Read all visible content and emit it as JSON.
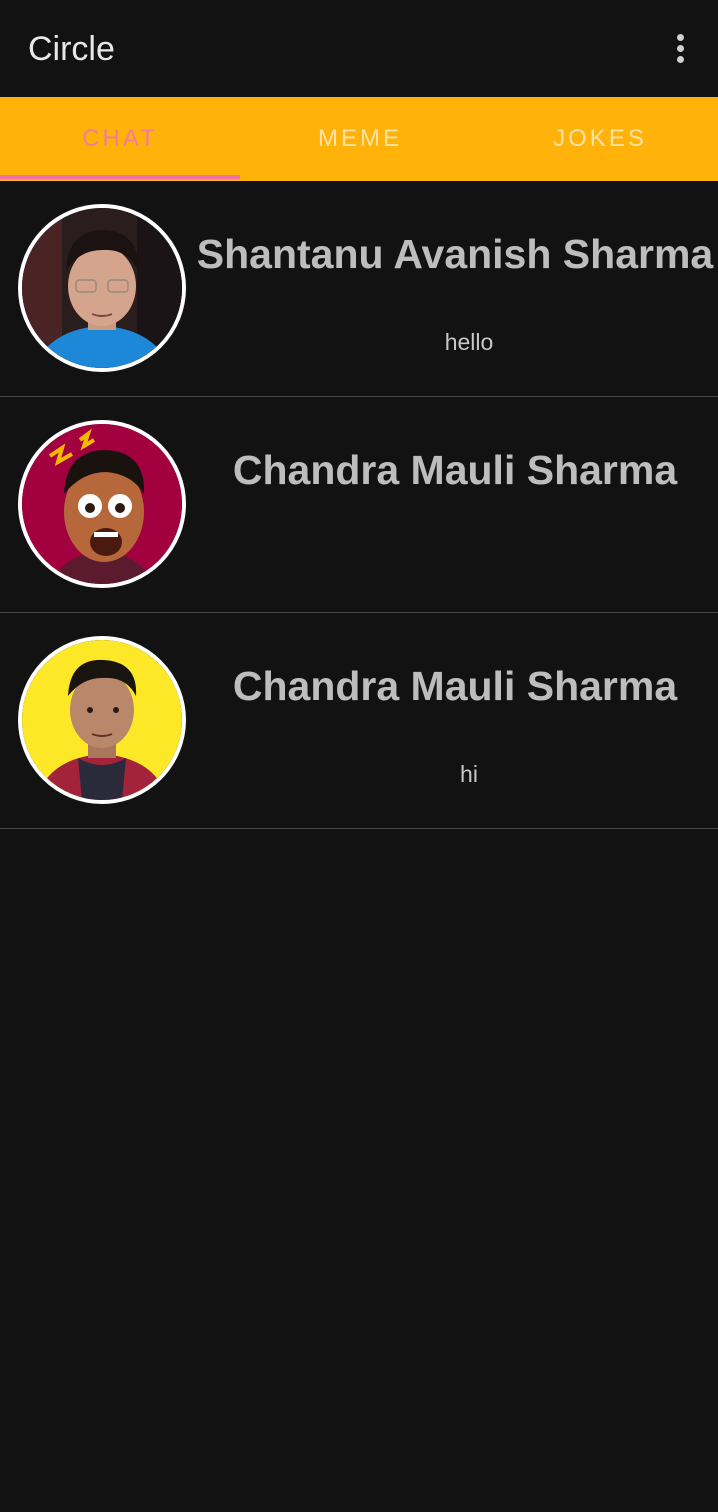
{
  "app": {
    "title": "Circle",
    "menu_icon": "more-vert-icon"
  },
  "tabs": [
    {
      "label": "CHAT",
      "selected": true
    },
    {
      "label": "MEME",
      "selected": false
    },
    {
      "label": "JOKES",
      "selected": false
    }
  ],
  "colors": {
    "background": "#121212",
    "tab_bar": "#ffb30a",
    "active_tab": "#f67aa0",
    "indicator": "#f56fa4"
  },
  "chats": [
    {
      "name": "Shantanu Avanish Sharma",
      "last_message": "hello",
      "avatar": "profile-photo"
    },
    {
      "name": "Chandra Mauli Sharma",
      "last_message": "",
      "avatar": "cartoon-avatar"
    },
    {
      "name": "Chandra Mauli Sharma",
      "last_message": "hi",
      "avatar": "profile-photo"
    }
  ]
}
